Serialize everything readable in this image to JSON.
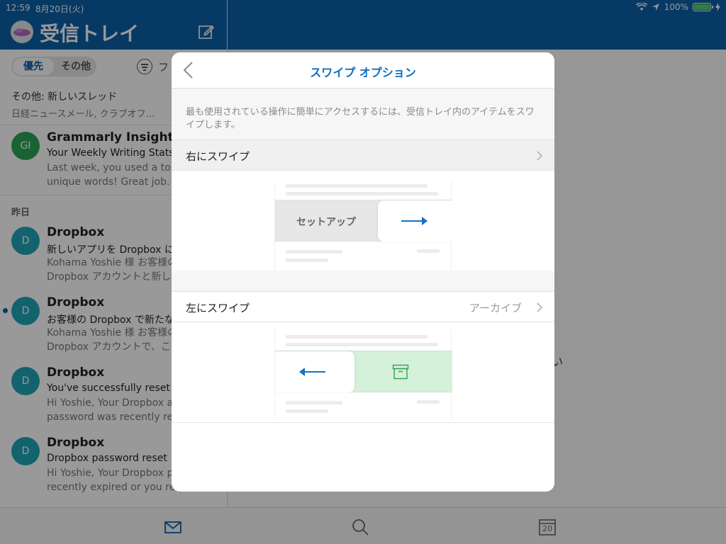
{
  "status": {
    "time": "12:59",
    "date": "8月20日(火)",
    "battery": "100%"
  },
  "header": {
    "title": "受信トレイ"
  },
  "tabs": {
    "focused": "優先",
    "other": "その他",
    "filter": "フ"
  },
  "other_threads": {
    "title": "その他: 新しいスレッド",
    "senders": "日経ニュースメール, クラブオフ…"
  },
  "sections": {
    "yesterday": "昨日"
  },
  "mails": [
    {
      "initials": "GI",
      "from": "Grammarly Insights",
      "subject": "Your Weekly Writing Stats",
      "preview": "Last week, you used a ton\nunique words! Great job. W",
      "color": "#2aa556",
      "unread": false
    },
    {
      "initials": "D",
      "from": "Dropbox",
      "subject": "新しいアプリを Dropbox に",
      "preview": "Kohama Yoshie 様 お客様の\nDropbox アカウントと新し",
      "color": "#21a6b8",
      "unread": false
    },
    {
      "initials": "D",
      "from": "Dropbox",
      "subject": "お客様の Dropbox で新たな",
      "preview": "Kohama Yoshie 様 お客様の\nDropbox アカウントで、こ",
      "color": "#21a6b8",
      "unread": true
    },
    {
      "initials": "D",
      "from": "Dropbox",
      "subject": "You've successfully reset",
      "preview": "Hi Yoshie, Your Dropbox a\npassword was recently res",
      "color": "#21a6b8",
      "unread": false
    },
    {
      "initials": "D",
      "from": "Dropbox",
      "subject": "Dropbox password reset",
      "preview": "Hi Yoshie, Your Dropbox p\nrecently expired or you requested",
      "color": "#21a6b8",
      "unread": false
    }
  ],
  "right_peek": "い",
  "modal": {
    "title": "スワイプ オプション",
    "description": "最も使用されている操作に簡単にアクセスするには、受信トレイ内のアイテムをスワイプします。",
    "swipe_right": {
      "label": "右にスワイプ",
      "action_label": "セットアップ"
    },
    "swipe_left": {
      "label": "左にスワイプ",
      "value": "アーカイブ"
    }
  },
  "tabbar": {
    "calendar_day": "20"
  },
  "colors": {
    "brand": "#0d5fa8",
    "accent": "#0e6ec0",
    "archive_green": "#d6f1da"
  }
}
